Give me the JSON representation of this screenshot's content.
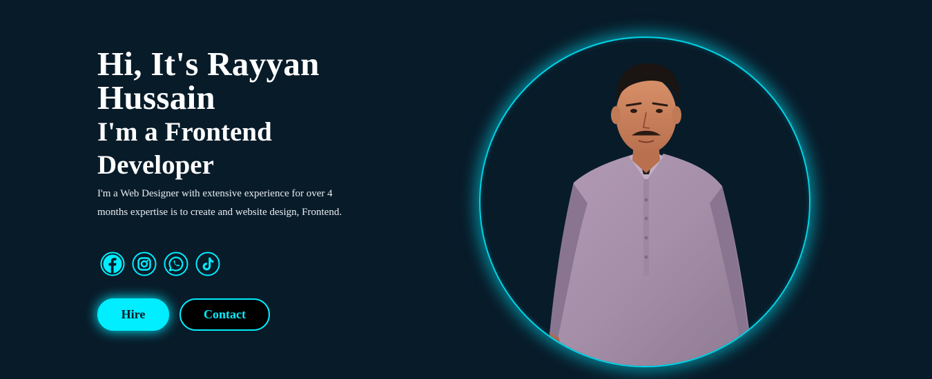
{
  "hero": {
    "title": "Hi, It's Rayyan Hussain",
    "subtitle": "I'm a Frontend Developer",
    "description": "I'm a Web Designer with extensive experience for over 4 months expertise is to create and website design, Frontend."
  },
  "socials": [
    {
      "icon": "facebook-icon"
    },
    {
      "icon": "instagram-icon"
    },
    {
      "icon": "whatsapp-icon"
    },
    {
      "icon": "tiktok-icon"
    }
  ],
  "buttons": {
    "hire_label": "Hire",
    "contact_label": "Contact"
  },
  "colors": {
    "background": "#081b29",
    "accent": "#00eeff",
    "text": "#ffffff"
  }
}
